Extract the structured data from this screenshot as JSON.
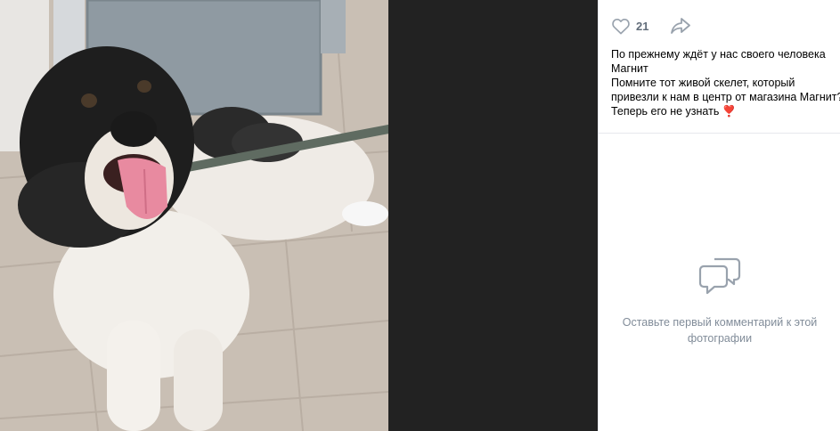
{
  "post": {
    "likes": "21",
    "description": [
      "По прежнему ждёт у нас своего человека",
      "Магнит",
      "Помните тот живой скелет, который",
      "привезли к нам в центр от магазина Магнит?",
      "Теперь его не узнать ❣️"
    ]
  },
  "comments": {
    "empty_line1": "Оставьте первый комментарий к этой",
    "empty_line2": "фотографии"
  },
  "icons": {
    "like": "heart-outline-icon",
    "share": "share-arrow-icon",
    "comments_empty": "speech-bubbles-icon"
  },
  "colors": {
    "accent_muted": "#818c99",
    "like_icon": "#99a2ad",
    "viewer_bg": "#222222"
  }
}
